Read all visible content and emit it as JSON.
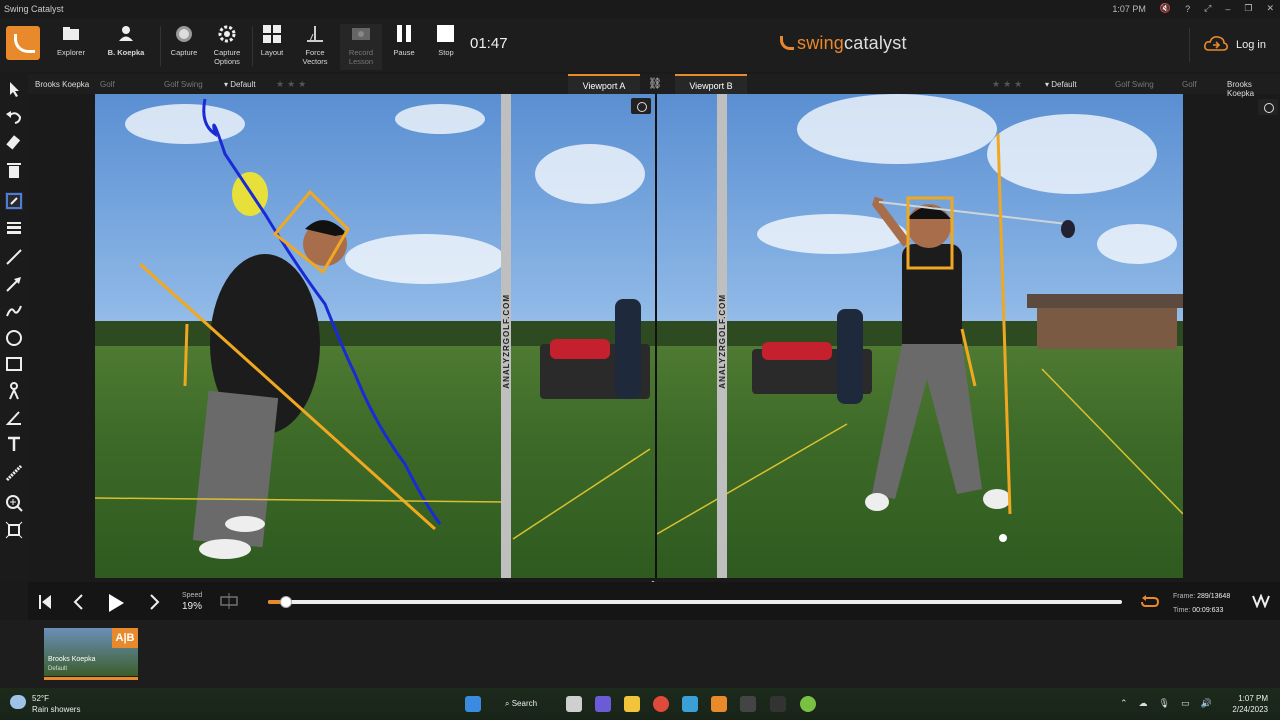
{
  "window": {
    "title": "Swing Catalyst",
    "clock": "1:07 PM"
  },
  "toolbar": {
    "explorer": "Explorer",
    "athlete": "B. Koepka",
    "capture": "Capture",
    "capture_options": "Capture Options",
    "layout": "Layout",
    "force_vectors": "Force Vectors",
    "record_lesson": "Record Lesson",
    "pause": "Pause",
    "stop": "Stop",
    "timer": "01:47",
    "brand_a": "swing",
    "brand_b": "catalyst",
    "login": "Log in"
  },
  "viewport_bar": {
    "left": {
      "athlete": "Brooks Koepka",
      "sport": "Golf",
      "category": "Golf Swing",
      "preset": "Default"
    },
    "tab_a": "Viewport A",
    "tab_b": "Viewport B",
    "right": {
      "athlete": "Brooks Koepka",
      "sport": "Golf",
      "category": "Golf Swing",
      "preset": "Default"
    }
  },
  "video": {
    "watermark": "ANALYZRGOLF.COM"
  },
  "playback": {
    "speed_label": "Speed",
    "speed_value": "19%",
    "progress": 0.021,
    "frame_label": "Frame:",
    "frame_value": "289/13648",
    "time_label": "Time:",
    "time_value": "00:09:633"
  },
  "clips": [
    {
      "badge": "A|B",
      "name": "Brooks Koepka",
      "preset": "Default"
    }
  ],
  "taskbar": {
    "weather_temp": "52°F",
    "weather_desc": "Rain showers",
    "search": "Search",
    "time": "1:07 PM",
    "date": "2/24/2023"
  },
  "colors": {
    "accent": "#e8892b",
    "drawing_yellow": "#f0a820",
    "drawing_blue": "#1a2bd6"
  }
}
